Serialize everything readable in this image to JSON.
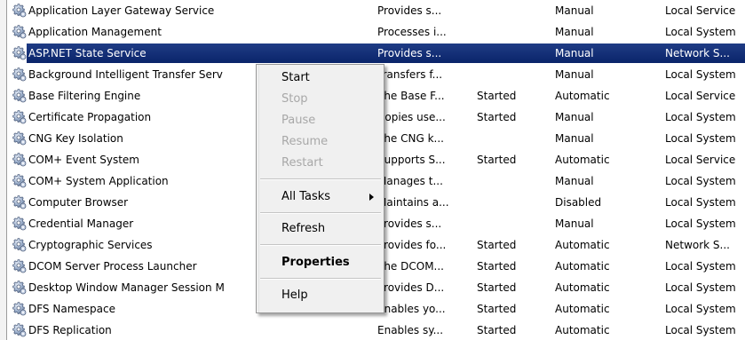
{
  "services": [
    {
      "name": "Application Layer Gateway Service",
      "description": "Provides s...",
      "status": "",
      "startup": "Manual",
      "logon": "Local Service"
    },
    {
      "name": "Application Management",
      "description": "Processes i...",
      "status": "",
      "startup": "Manual",
      "logon": "Local System"
    },
    {
      "name": "ASP.NET State Service",
      "description": "Provides s...",
      "status": "",
      "startup": "Manual",
      "logon": "Network S..."
    },
    {
      "name": "Background Intelligent Transfer Serv",
      "description": "Transfers f...",
      "status": "",
      "startup": "Manual",
      "logon": "Local System"
    },
    {
      "name": "Base Filtering Engine",
      "description": "The Base F...",
      "status": "Started",
      "startup": "Automatic",
      "logon": "Local Service"
    },
    {
      "name": "Certificate Propagation",
      "description": "Copies use...",
      "status": "Started",
      "startup": "Manual",
      "logon": "Local System"
    },
    {
      "name": "CNG Key Isolation",
      "description": "The CNG k...",
      "status": "",
      "startup": "Manual",
      "logon": "Local System"
    },
    {
      "name": "COM+ Event System",
      "description": "Supports S...",
      "status": "Started",
      "startup": "Automatic",
      "logon": "Local Service"
    },
    {
      "name": "COM+ System Application",
      "description": "Manages t...",
      "status": "",
      "startup": "Manual",
      "logon": "Local System"
    },
    {
      "name": "Computer Browser",
      "description": "Maintains a...",
      "status": "",
      "startup": "Disabled",
      "logon": "Local System"
    },
    {
      "name": "Credential Manager",
      "description": "Provides s...",
      "status": "",
      "startup": "Manual",
      "logon": "Local System"
    },
    {
      "name": "Cryptographic Services",
      "description": "Provides fo...",
      "status": "Started",
      "startup": "Automatic",
      "logon": "Network S..."
    },
    {
      "name": "DCOM Server Process Launcher",
      "description": "The DCOM...",
      "status": "Started",
      "startup": "Automatic",
      "logon": "Local System"
    },
    {
      "name": "Desktop Window Manager Session M",
      "description": "Provides D...",
      "status": "Started",
      "startup": "Automatic",
      "logon": "Local System"
    },
    {
      "name": "DFS Namespace",
      "description": "Enables yo...",
      "status": "Started",
      "startup": "Automatic",
      "logon": "Local System"
    },
    {
      "name": "DFS Replication",
      "description": "Enables sy...",
      "status": "Started",
      "startup": "Automatic",
      "logon": "Local System"
    }
  ],
  "selected_index": 2,
  "context_menu": {
    "start": "Start",
    "stop": "Stop",
    "pause": "Pause",
    "resume": "Resume",
    "restart": "Restart",
    "all_tasks": "All Tasks",
    "refresh": "Refresh",
    "properties": "Properties",
    "help": "Help"
  },
  "icon": "service-gear-icon",
  "colors": {
    "selection": "#0a246a",
    "menu_background": "#f0f0f0",
    "disabled_text": "#a8a8a8"
  }
}
